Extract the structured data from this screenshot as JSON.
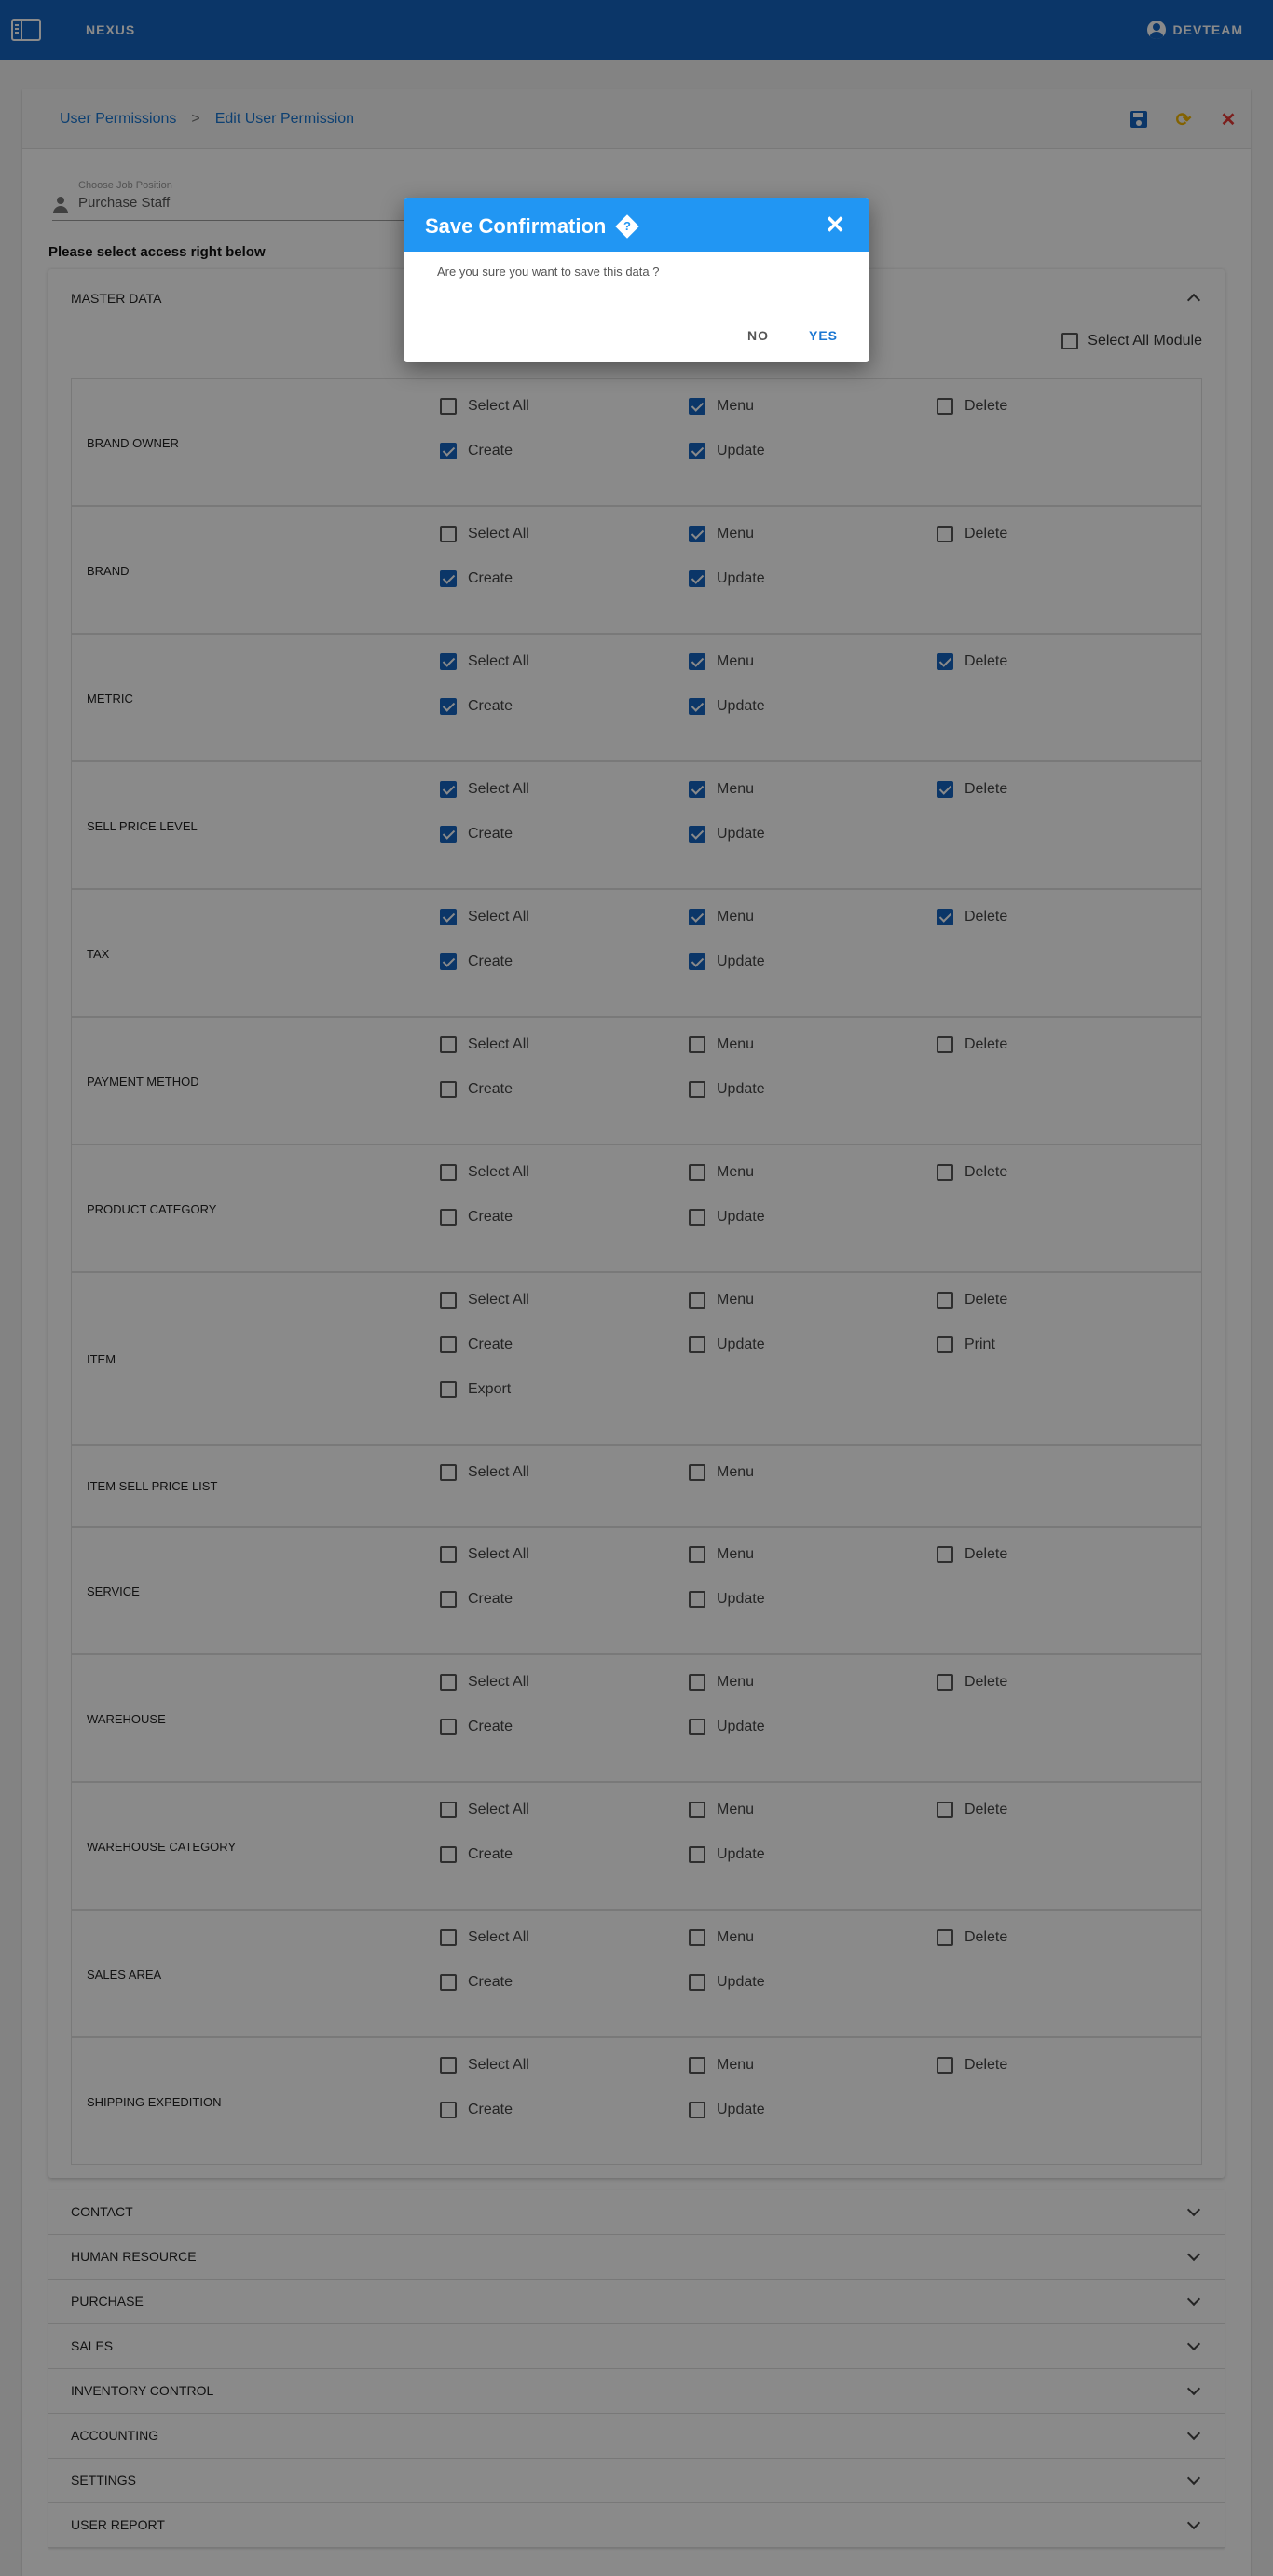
{
  "topbar": {
    "brand": "NEXUS",
    "user": "DEVTEAM"
  },
  "breadcrumb": {
    "parent": "User Permissions",
    "separator": ">",
    "current": "Edit User Permission"
  },
  "job_position": {
    "label": "Choose Job Position",
    "value": "Purchase Staff"
  },
  "instruction": "Please select access right below",
  "master": {
    "title": "MASTER DATA",
    "select_all_module": "Select All Module",
    "rows": [
      {
        "name": "BRAND OWNER",
        "items": [
          {
            "label": "Select All",
            "checked": false
          },
          {
            "label": "Menu",
            "checked": true
          },
          {
            "label": "Delete",
            "checked": false
          },
          {
            "label": "Create",
            "checked": true
          },
          {
            "label": "Update",
            "checked": true
          }
        ]
      },
      {
        "name": "BRAND",
        "items": [
          {
            "label": "Select All",
            "checked": false
          },
          {
            "label": "Menu",
            "checked": true
          },
          {
            "label": "Delete",
            "checked": false
          },
          {
            "label": "Create",
            "checked": true
          },
          {
            "label": "Update",
            "checked": true
          }
        ]
      },
      {
        "name": "METRIC",
        "items": [
          {
            "label": "Select All",
            "checked": true
          },
          {
            "label": "Menu",
            "checked": true
          },
          {
            "label": "Delete",
            "checked": true
          },
          {
            "label": "Create",
            "checked": true
          },
          {
            "label": "Update",
            "checked": true
          }
        ]
      },
      {
        "name": "SELL PRICE LEVEL",
        "items": [
          {
            "label": "Select All",
            "checked": true
          },
          {
            "label": "Menu",
            "checked": true
          },
          {
            "label": "Delete",
            "checked": true
          },
          {
            "label": "Create",
            "checked": true
          },
          {
            "label": "Update",
            "checked": true
          }
        ]
      },
      {
        "name": "TAX",
        "items": [
          {
            "label": "Select All",
            "checked": true
          },
          {
            "label": "Menu",
            "checked": true
          },
          {
            "label": "Delete",
            "checked": true
          },
          {
            "label": "Create",
            "checked": true
          },
          {
            "label": "Update",
            "checked": true
          }
        ]
      },
      {
        "name": "PAYMENT METHOD",
        "items": [
          {
            "label": "Select All",
            "checked": false
          },
          {
            "label": "Menu",
            "checked": false
          },
          {
            "label": "Delete",
            "checked": false
          },
          {
            "label": "Create",
            "checked": false
          },
          {
            "label": "Update",
            "checked": false
          }
        ]
      },
      {
        "name": "PRODUCT CATEGORY",
        "items": [
          {
            "label": "Select All",
            "checked": false
          },
          {
            "label": "Menu",
            "checked": false
          },
          {
            "label": "Delete",
            "checked": false
          },
          {
            "label": "Create",
            "checked": false
          },
          {
            "label": "Update",
            "checked": false
          }
        ]
      },
      {
        "name": "ITEM",
        "items": [
          {
            "label": "Select All",
            "checked": false
          },
          {
            "label": "Menu",
            "checked": false
          },
          {
            "label": "Delete",
            "checked": false
          },
          {
            "label": "Create",
            "checked": false
          },
          {
            "label": "Update",
            "checked": false
          },
          {
            "label": "Print",
            "checked": false
          },
          {
            "label": "Export",
            "checked": false
          }
        ]
      },
      {
        "name": "ITEM SELL PRICE LIST",
        "items": [
          {
            "label": "Select All",
            "checked": false
          },
          {
            "label": "Menu",
            "checked": false
          }
        ]
      },
      {
        "name": "SERVICE",
        "items": [
          {
            "label": "Select All",
            "checked": false
          },
          {
            "label": "Menu",
            "checked": false
          },
          {
            "label": "Delete",
            "checked": false
          },
          {
            "label": "Create",
            "checked": false
          },
          {
            "label": "Update",
            "checked": false
          }
        ]
      },
      {
        "name": "WAREHOUSE",
        "items": [
          {
            "label": "Select All",
            "checked": false
          },
          {
            "label": "Menu",
            "checked": false
          },
          {
            "label": "Delete",
            "checked": false
          },
          {
            "label": "Create",
            "checked": false
          },
          {
            "label": "Update",
            "checked": false
          }
        ]
      },
      {
        "name": "WAREHOUSE CATEGORY",
        "items": [
          {
            "label": "Select All",
            "checked": false
          },
          {
            "label": "Menu",
            "checked": false
          },
          {
            "label": "Delete",
            "checked": false
          },
          {
            "label": "Create",
            "checked": false
          },
          {
            "label": "Update",
            "checked": false
          }
        ]
      },
      {
        "name": "SALES AREA",
        "items": [
          {
            "label": "Select All",
            "checked": false
          },
          {
            "label": "Menu",
            "checked": false
          },
          {
            "label": "Delete",
            "checked": false
          },
          {
            "label": "Create",
            "checked": false
          },
          {
            "label": "Update",
            "checked": false
          }
        ]
      },
      {
        "name": "SHIPPING EXPEDITION",
        "items": [
          {
            "label": "Select All",
            "checked": false
          },
          {
            "label": "Menu",
            "checked": false
          },
          {
            "label": "Delete",
            "checked": false
          },
          {
            "label": "Create",
            "checked": false
          },
          {
            "label": "Update",
            "checked": false
          }
        ]
      }
    ]
  },
  "sections": [
    "CONTACT",
    "HUMAN RESOURCE",
    "PURCHASE",
    "SALES",
    "INVENTORY CONTROL",
    "ACCOUNTING",
    "SETTINGS",
    "USER REPORT"
  ],
  "dialog": {
    "title": "Save Confirmation",
    "message": "Are you sure you want to save this data ?",
    "no_label": "NO",
    "yes_label": "YES"
  },
  "icons": {
    "menu": "sidebar-toggle-icon",
    "user": "account-circle-icon",
    "save": "save-icon",
    "refresh": "refresh-icon",
    "close": "close-icon",
    "person": "person-icon",
    "help": "help-diamond-icon"
  },
  "colors": {
    "primary": "#1565c0",
    "dialog_header": "#2196f3",
    "refresh": "#f2b600",
    "close": "#e53935"
  }
}
